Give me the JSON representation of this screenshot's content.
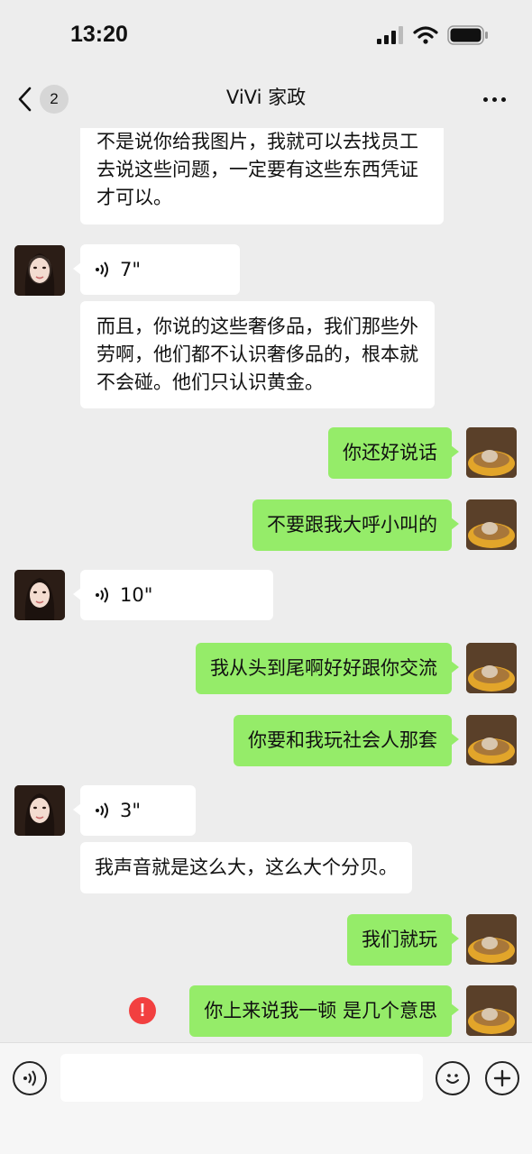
{
  "status_bar": {
    "time": "13:20"
  },
  "nav": {
    "badge_count": "2",
    "title": "ViVi 家政"
  },
  "messages": [
    {
      "side": "in",
      "type": "text",
      "text": "不是说你给我图片，我就可以去找员工去说这些问题，一定要有这些东西凭证才可以。"
    },
    {
      "side": "in",
      "type": "voice",
      "duration": "7\""
    },
    {
      "side": "in",
      "type": "text",
      "text": "而且，你说的这些奢侈品，我们那些外劳啊，他们都不认识奢侈品的，根本就不会碰。他们只认识黄金。"
    },
    {
      "side": "out",
      "type": "text",
      "text": "你还好说话"
    },
    {
      "side": "out",
      "type": "text",
      "text": "不要跟我大呼小叫的"
    },
    {
      "side": "in",
      "type": "voice",
      "duration": "10\""
    },
    {
      "side": "out",
      "type": "text",
      "text": "我从头到尾啊好好跟你交流"
    },
    {
      "side": "out",
      "type": "text",
      "text": "你要和我玩社会人那套"
    },
    {
      "side": "in",
      "type": "voice",
      "duration": "3\""
    },
    {
      "side": "in",
      "type": "text",
      "text": "我声音就是这么大，这么大个分贝。"
    },
    {
      "side": "out",
      "type": "text",
      "text": "我们就玩"
    },
    {
      "side": "out",
      "type": "text",
      "text": "你上来说我一顿 是几个意思",
      "error": true
    }
  ],
  "input": {
    "value": ""
  },
  "colors": {
    "outgoing_bubble": "#95ec69",
    "incoming_bubble": "#ffffff",
    "error": "#f24040",
    "background": "#ededed"
  },
  "icons": [
    "back-chevron-icon",
    "more-dots-icon",
    "voice-wave-icon",
    "error-icon",
    "voice-input-icon",
    "emoji-icon",
    "add-icon"
  ]
}
